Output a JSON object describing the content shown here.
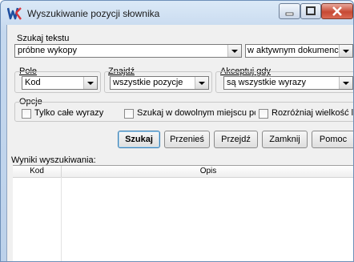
{
  "window": {
    "title": "Wyszukiwanie pozycji słownika"
  },
  "search": {
    "label": "Szukaj tekstu",
    "value": "próbne wykopy",
    "scope": "w aktywnym dokumenci"
  },
  "field": {
    "label": "Pole",
    "value": "Kod"
  },
  "find": {
    "label": "Znajdź",
    "value": "wszystkie pozycje"
  },
  "accept": {
    "label": "Akceptuj gdy",
    "value": "są wszystkie wyrazy"
  },
  "options": {
    "label": "Opcje",
    "whole_words": "Tylko całe wyrazy",
    "anywhere": "Szukaj w dowolnym miejscu pc",
    "case": "Rozróżniaj wielkość lit"
  },
  "buttons": {
    "search": "Szukaj",
    "move": "Przenieś",
    "goto": "Przejdź",
    "close": "Zamknij",
    "help": "Pomoc"
  },
  "results": {
    "label": "Wyniki wyszukiwania:",
    "columns": [
      "Kod",
      "Opis"
    ]
  },
  "colors": {
    "accent": "#3c7fb1",
    "close_button": "#c74a34",
    "logo": "#1f4f9f"
  }
}
